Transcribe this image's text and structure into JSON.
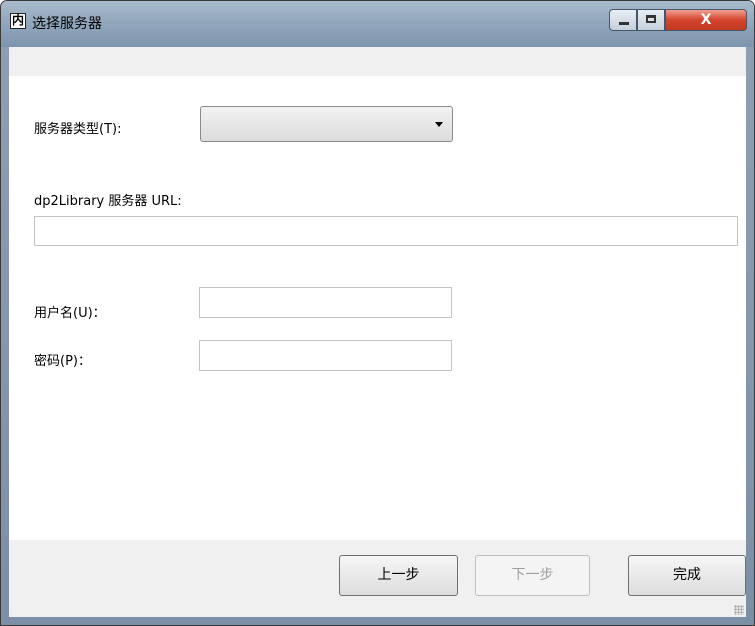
{
  "window": {
    "title": "选择服务器",
    "icon": "内",
    "close_glyph": "X"
  },
  "form": {
    "server_type_label": "服务器类型(T):",
    "server_type_value": "",
    "url_label": "dp2Library 服务器 URL:",
    "url_value": "",
    "username_label": "用户名(U)：",
    "username_value": "",
    "password_label": "密码(P)：",
    "password_value": ""
  },
  "buttons": {
    "prev": "上一步",
    "next": "下一步",
    "finish": "完成"
  }
}
